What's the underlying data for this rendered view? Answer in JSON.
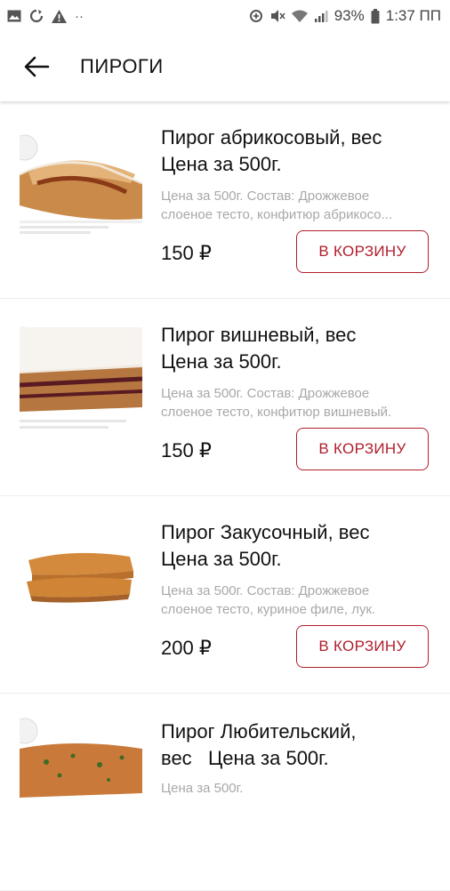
{
  "status_bar": {
    "battery": "93%",
    "time": "1:37 ПП",
    "icons": [
      "gallery-icon",
      "sync-icon",
      "warning-icon",
      "more-dots-icon",
      "data-saver-icon",
      "mute-icon",
      "wifi-icon",
      "signal-icon",
      "battery-icon"
    ]
  },
  "header": {
    "title": "ПИРОГИ",
    "back_icon": "arrow-left-icon"
  },
  "products": [
    {
      "title_line1": "Пирог абрикосовый, вес",
      "title_line2": "Цена за 500г.",
      "desc_line1": "Цена за 500г. Состав: Дрожжевое",
      "desc_line2": "слоеное тесто, конфитюр абрикосо...",
      "price": "150 ₽",
      "button": "В КОРЗИНУ"
    },
    {
      "title_line1": "Пирог вишневый, вес",
      "title_line2": "Цена за 500г.",
      "desc_line1": "Цена за 500г. Состав: Дрожжевое",
      "desc_line2": "слоеное тесто, конфитюр вишневый.",
      "price": "150 ₽",
      "button": "В КОРЗИНУ"
    },
    {
      "title_line1": "Пирог Закусочный, вес",
      "title_line2": "Цена за 500г.",
      "desc_line1": "Цена за 500г. Состав: Дрожжевое",
      "desc_line2": "слоеное тесто, куриное филе, лук.",
      "price": "200 ₽",
      "button": "В КОРЗИНУ"
    },
    {
      "title_line1": "Пирог Любительский,",
      "title_line2": "вес   Цена за 500г.",
      "desc_line1": "Цена за 500г."
    }
  ],
  "colors": {
    "accent": "#b01e2c",
    "muted_text": "#a8a8a8"
  }
}
